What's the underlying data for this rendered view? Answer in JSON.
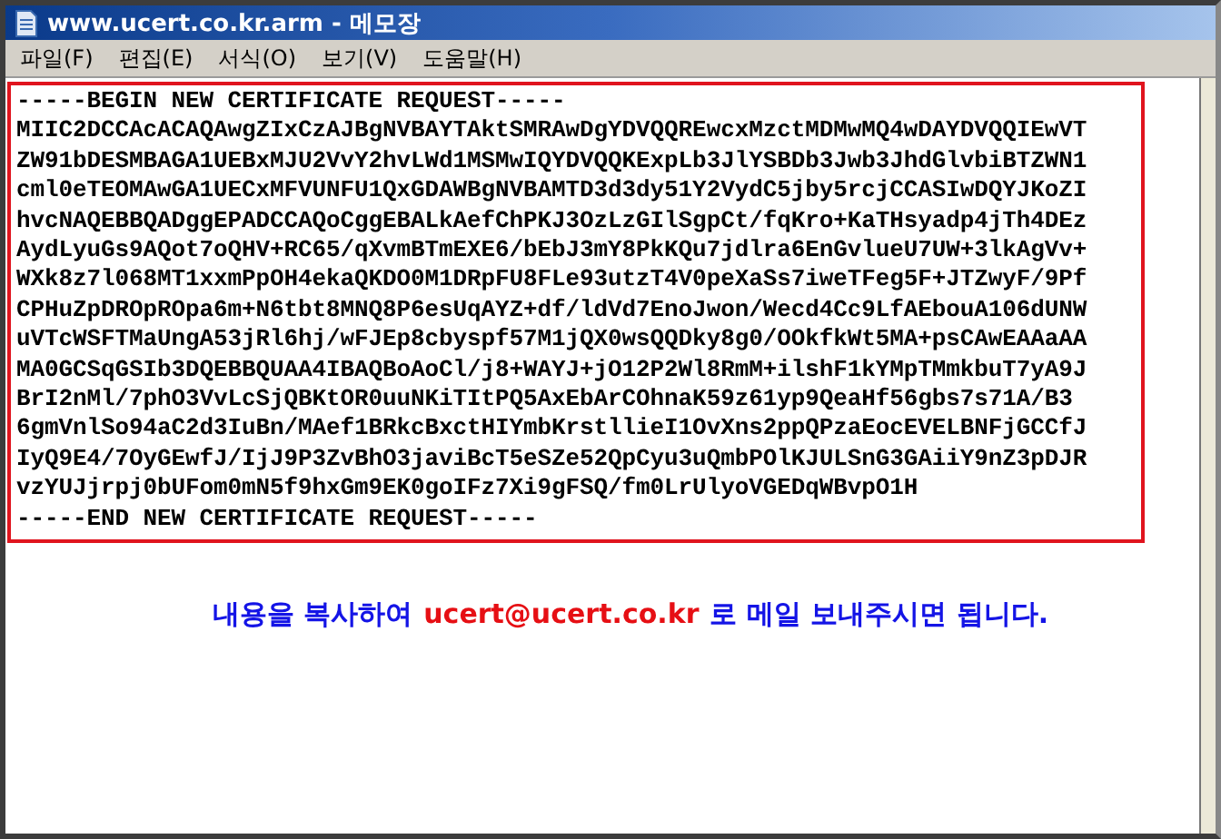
{
  "window": {
    "title": "www.ucert.co.kr.arm - 메모장"
  },
  "menu": [
    {
      "label": "파일(F)"
    },
    {
      "label": "편집(E)"
    },
    {
      "label": "서식(O)"
    },
    {
      "label": "보기(V)"
    },
    {
      "label": "도움말(H)"
    }
  ],
  "certificate_lines": [
    "-----BEGIN NEW CERTIFICATE REQUEST-----",
    "MIIC2DCCAcACAQAwgZIxCzAJBgNVBAYTAktSMRAwDgYDVQQREwcxMzctMDMwMQ4wDAYDVQQIEwVT",
    "ZW91bDESMBAGA1UEBxMJU2VvY2hvLWd1MSMwIQYDVQQKExpLb3JlYSBDb3Jwb3JhdGlvbiBTZWN1",
    "cml0eTEOMAwGA1UECxMFVUNFU1QxGDAWBgNVBAMTD3d3dy51Y2VydC5jby5rcjCCASIwDQYJKoZI",
    "hvcNAQEBBQADggEPADCCAQoCggEBALkAefChPKJ3OzLzGIlSgpCt/fqKro+KaTHsyadp4jTh4DEz",
    "AydLyuGs9AQot7oQHV+RC65/qXvmBTmEXE6/bEbJ3mY8PkKQu7jdlra6EnGvlueU7UW+3lkAgVv+",
    "WXk8z7l068MT1xxmPpOH4ekaQKDO0M1DRpFU8FLe93utzT4V0peXaSs7iweTFeg5F+JTZwyF/9Pf",
    "CPHuZpDROpROpa6m+N6tbt8MNQ8P6esUqAYZ+df/ldVd7EnoJwon/Wecd4Cc9LfAEbouA106dUNW",
    "uVTcWSFTMaUngA53jRl6hj/wFJEp8cbyspf57M1jQX0wsQQDky8g0/OOkfkWt5MA+psCAwEAAaAA",
    "MA0GCSqGSIb3DQEBBQUAA4IBAQBoAoCl/j8+WAYJ+jO12P2Wl8RmM+ilshF1kYMpTMmkbuT7yA9J",
    "BrI2nMl/7phO3VvLcSjQBKtOR0uuNKiTItPQ5AxEbArCOhnaK59z61yp9QeaHf56gbs7s71A/B3",
    "6gmVnlSo94aC2d3IuBn/MAef1BRkcBxctHIYmbKrstllieI1OvXns2ppQPzaEocEVELBNFjGCCfJ",
    "IyQ9E4/7OyGEwfJ/IjJ9P3ZvBhO3javiBcT5eSZe52QpCyu3uQmbPOlKJULSnG3GAiiY9nZ3pDJR",
    "vzYUJjrpj0bUFom0mN5f9hxGm9EK0goIFz7Xi9gFSQ/fm0LrUlyoVGEDqWBvpO1H",
    "-----END NEW CERTIFICATE REQUEST-----"
  ],
  "note": {
    "before": "내용을 복사하여",
    "email": "ucert@ucert.co.kr",
    "after": "로 메일 보내주시면 됩니다."
  }
}
